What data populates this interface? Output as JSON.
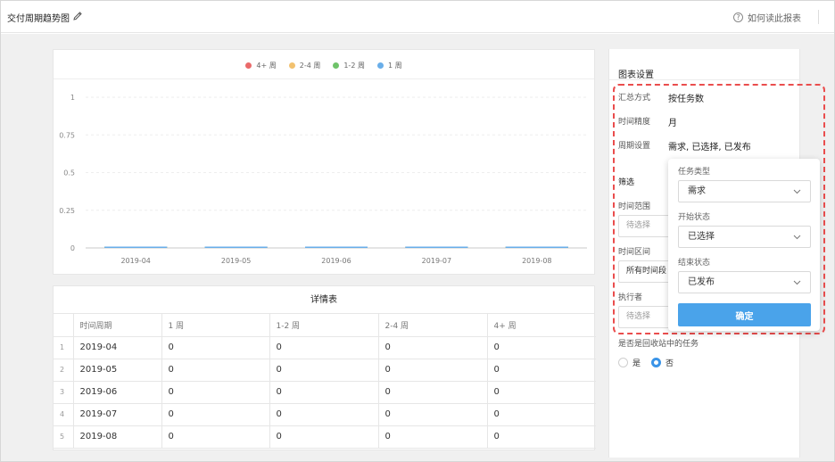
{
  "header": {
    "title": "交付周期趋势图",
    "help_link": "如何读此报表",
    "edit_icon": "pencil-icon",
    "help_icon": "question-circle-icon"
  },
  "chart_data": {
    "type": "bar",
    "categories": [
      "2019-04",
      "2019-05",
      "2019-06",
      "2019-07",
      "2019-08"
    ],
    "series": [
      {
        "name": "4+ 周",
        "color": "#ea6a6a",
        "values": [
          0,
          0,
          0,
          0,
          0
        ]
      },
      {
        "name": "2-4 周",
        "color": "#f2c16f",
        "values": [
          0,
          0,
          0,
          0,
          0
        ]
      },
      {
        "name": "1-2 周",
        "color": "#6fc36a",
        "values": [
          0,
          0,
          0,
          0,
          0
        ]
      },
      {
        "name": "1 周",
        "color": "#69aee9",
        "values": [
          0,
          0,
          0,
          0,
          0
        ]
      }
    ],
    "ylim": [
      0,
      1
    ],
    "yticks": [
      "1",
      "0.75",
      "0.5",
      "0.25",
      "0"
    ],
    "grid": true,
    "legend": "top-center"
  },
  "table": {
    "title": "详情表",
    "columns": [
      "时间周期",
      "1 周",
      "1-2 周",
      "2-4 周",
      "4+ 周"
    ],
    "rows": [
      {
        "index": "1",
        "period": "2019-04",
        "week1": "0",
        "week1_2": "0",
        "week2_4": "0",
        "week4plus": "0"
      },
      {
        "index": "2",
        "period": "2019-05",
        "week1": "0",
        "week1_2": "0",
        "week2_4": "0",
        "week4plus": "0"
      },
      {
        "index": "3",
        "period": "2019-06",
        "week1": "0",
        "week1_2": "0",
        "week2_4": "0",
        "week4plus": "0"
      },
      {
        "index": "4",
        "period": "2019-07",
        "week1": "0",
        "week1_2": "0",
        "week2_4": "0",
        "week4plus": "0"
      },
      {
        "index": "5",
        "period": "2019-08",
        "week1": "0",
        "week1_2": "0",
        "week2_4": "0",
        "week4plus": "0"
      }
    ]
  },
  "settings": {
    "title": "图表设置",
    "summary_label": "汇总方式",
    "summary_value": "按任务数",
    "granularity_label": "时间精度",
    "granularity_value": "月",
    "period_label": "周期设置",
    "period_value": "需求, 已选择, 已发布"
  },
  "filters": {
    "title": "筛选",
    "time_range_label": "时间范围",
    "time_range_placeholder": "待选择",
    "time_interval_label": "时间区间",
    "time_interval_value": "所有时间段",
    "assignee_label": "执行者",
    "assignee_placeholder": "待选择",
    "recycle_label": "是否是回收站中的任务",
    "recycle_options": [
      "是",
      "否"
    ],
    "recycle_selected": "否"
  },
  "period_panel": {
    "task_type_label": "任务类型",
    "task_type_value": "需求",
    "start_status_label": "开始状态",
    "start_status_value": "已选择",
    "end_status_label": "结束状态",
    "end_status_value": "已发布",
    "confirm_label": "确定",
    "chevron_icon": "chevron-down-icon"
  },
  "colors": {
    "accent": "#4aa3ea",
    "highlight": "#ea4d4d"
  }
}
